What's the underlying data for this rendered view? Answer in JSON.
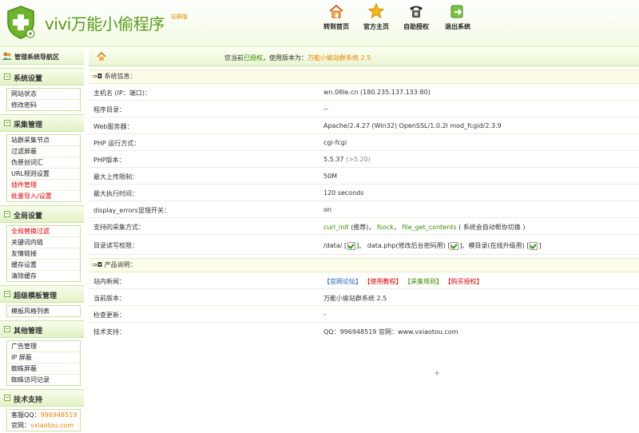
{
  "header": {
    "logo_text": "vivi万能小偷程序",
    "logo_sub": "站群版",
    "nav": [
      {
        "label": "转到首页",
        "icon": "home-icon"
      },
      {
        "label": "官方主页",
        "icon": "star-icon"
      },
      {
        "label": "自助授权",
        "icon": "phone-icon"
      },
      {
        "label": "退出系统",
        "icon": "exit-icon"
      }
    ]
  },
  "sidebar": {
    "title": "管理系统导航区",
    "groups": [
      {
        "label": "系统设置",
        "items": [
          "网站状态",
          "修改密码"
        ]
      },
      {
        "label": "采集管理",
        "items": [
          "站群采集节点",
          "过滤屏蔽",
          "伪原创词汇",
          "URL规则设置",
          "插件管理",
          "批量导入/设置"
        ]
      },
      {
        "label": "全局设置",
        "items": [
          "全局替换过滤",
          "关键词内链",
          "友情链接",
          "缓存设置",
          "清除缓存"
        ]
      },
      {
        "label": "超级模板管理",
        "items": [
          "模板风格列表"
        ]
      },
      {
        "label": "其他管理",
        "items": [
          "广告管理",
          "IP 屏蔽",
          "蜘蛛屏蔽",
          "蜘蛛访问记录"
        ]
      },
      {
        "label": "技术支持",
        "items": []
      }
    ],
    "contact": {
      "qq_label": "客服QQ：",
      "qq": "996948519",
      "site_label": "官网：",
      "site": "vxiaotou.com"
    }
  },
  "main": {
    "status_prefix": "您当前",
    "status_auth": "已授权",
    "status_mid": "，使用版本为：",
    "status_version": "万能小偷站群系统 2.5",
    "sys_section": "系统信息：",
    "sys_rows": [
      {
        "label": "主机名 (IP：端口)：",
        "value": "wn.08le.cn  (180.235.137.133:80)"
      },
      {
        "label": "程序目录：",
        "value": "--"
      },
      {
        "label": "Web服务器：",
        "value": "Apache/2.4.27 (Win32) OpenSSL/1.0.2l mod_fcgid/2.3.9"
      },
      {
        "label": "PHP 运行方式：",
        "value": "cgi-fcgi"
      },
      {
        "label": "PHP版本：",
        "value": "5.5.37",
        "extra": "(>5.20)"
      },
      {
        "label": "最大上传限制：",
        "value": "50M"
      },
      {
        "label": "最大执行时间：",
        "value": "120 seconds"
      },
      {
        "label": "display_errors显错开关：",
        "value": "on"
      }
    ],
    "methods": {
      "label": "支持的采集方式：",
      "a": "curl_init",
      "a_note": "(推荐)，",
      "b": "fsock",
      "c": "file_get_contents",
      "note": "( 系统会自动帮你切换 )"
    },
    "perms": {
      "label": "目录读写权限：",
      "p1": "/data/ [",
      "p2": "]、 data.php(修改后台密码用) [",
      "p3": "]、模目录(在线升级用) ["
    },
    "prod_section": "产品说明：",
    "news": {
      "label": "站内新闻：",
      "links": [
        "【官网论坛】",
        "【使用教程】",
        "【采集规则】",
        "【购买授权】"
      ]
    },
    "prod_rows": [
      {
        "label": "当前版本：",
        "value": "万能小偷站群系统 2.5"
      },
      {
        "label": "检查更新：",
        "value": "-"
      },
      {
        "label": "技术支持：",
        "value": "QQ：996948519    官网：www.vxiaotou.com"
      }
    ]
  },
  "colors": {
    "accent_green": "#5a9a1a",
    "link_blue": "#1a5fb4",
    "link_red": "#e00000",
    "orange": "#f08000"
  }
}
